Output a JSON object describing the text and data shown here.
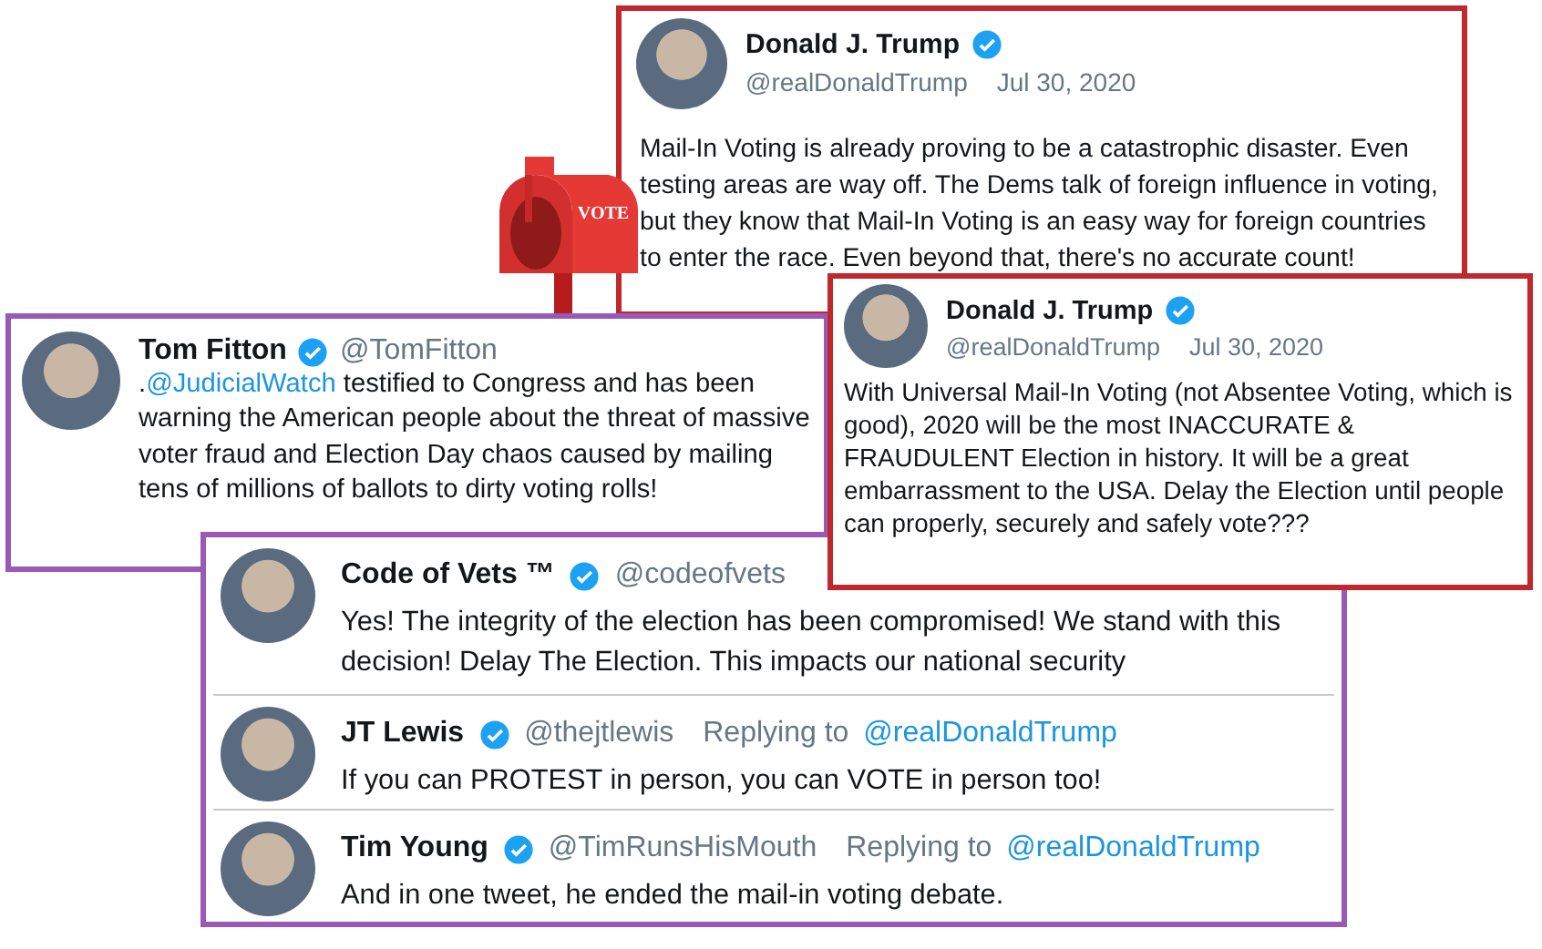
{
  "tweet_top": {
    "author": "Donald J. Trump",
    "verified": true,
    "handle": "@realDonaldTrump",
    "date": "Jul 30, 2020",
    "text": "Mail-In Voting is already proving to be a catastrophic disaster. Even testing areas are way off. The Dems talk of foreign influence in voting, but they know that Mail-In Voting is an easy way for foreign countries to enter the race. Even beyond that, there's no accurate count!",
    "color": "#c0282d"
  },
  "mailbox": {
    "label": "VOTE"
  },
  "tweet_fitton": {
    "author": "Tom Fitton",
    "verified": true,
    "handle": "@TomFitton",
    "prefix": ".",
    "mention": "@JudicialWatch",
    "text": " testified to Congress and has been warning the American people about the threat of massive voter fraud and  Election Day chaos caused by mailing tens of millions of ballots to dirty voting rolls!",
    "color": "#9b59b6"
  },
  "tweet_right": {
    "author": "Donald J. Trump",
    "verified": true,
    "handle": "@realDonaldTrump",
    "date": "Jul 30, 2020",
    "text": "With Universal Mail-In Voting (not Absentee Voting, which is good), 2020 will be the most INACCURATE & FRAUDULENT Election in history. It will be a great embarrassment to the USA. Delay the Election until people can properly, securely and safely vote???",
    "color": "#c0282d"
  },
  "replies": {
    "color": "#9b59b6",
    "items": [
      {
        "author": "Code of Vets ™",
        "verified": true,
        "handle": "@codeofvets",
        "text": "Yes! The integrity of the election has been compromised! We stand with this decision!  Delay The Election. This impacts our national security"
      },
      {
        "author": "JT Lewis",
        "verified": true,
        "handle": "@thejtlewis",
        "replying_label": "Replying to",
        "replying_to": "@realDonaldTrump",
        "text": "If you can PROTEST in person, you can VOTE in person too!"
      },
      {
        "author": "Tim Young",
        "verified": true,
        "handle": "@TimRunsHisMouth",
        "replying_label": "Replying to",
        "replying_to": "@realDonaldTrump",
        "text": "And in one tweet, he ended the mail-in voting debate."
      }
    ]
  }
}
